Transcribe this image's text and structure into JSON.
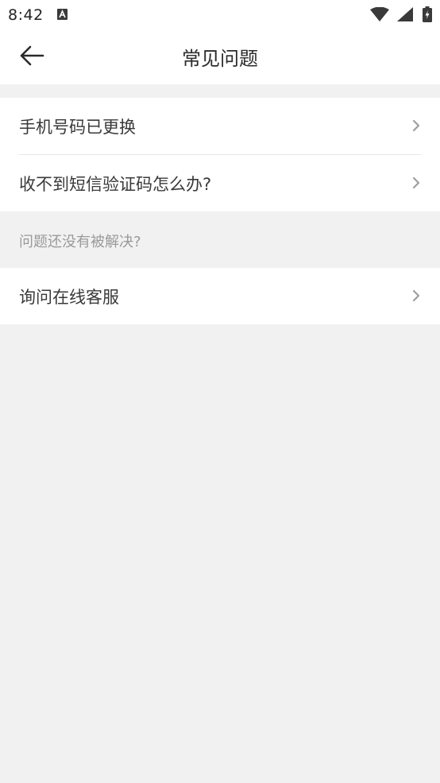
{
  "status_bar": {
    "time": "8:42"
  },
  "app_bar": {
    "title": "常见问题"
  },
  "faq_items": [
    {
      "label": "手机号码已更换"
    },
    {
      "label": "收不到短信验证码怎么办?"
    }
  ],
  "section_caption": "问题还没有被解决?",
  "support_items": [
    {
      "label": "询问在线客服"
    }
  ],
  "colors": {
    "background": "#f1f1f1",
    "surface": "#ffffff",
    "text_primary": "#3a3a3a",
    "text_secondary": "#9a9a9a",
    "chevron": "#9e9e9e"
  },
  "icons": {
    "back": "arrow-left-icon",
    "row_chevron": "chevron-right-icon"
  }
}
